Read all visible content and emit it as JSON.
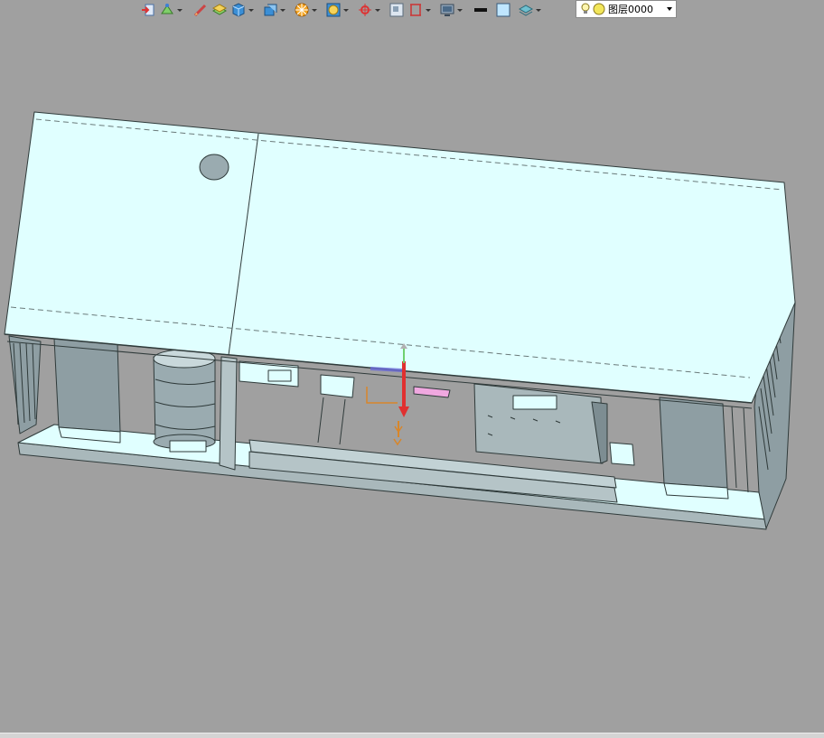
{
  "toolbar": {
    "icons": [
      "import-icon",
      "axis-insert-icon",
      "sketch-icon",
      "layer-box-icon",
      "solid-box-icon",
      "extrude-icon",
      "wheel-pattern-icon",
      "ring-icon",
      "point-constraint-icon",
      "grid-view-icon",
      "frame-view-icon",
      "monitor-view-icon",
      "black-line-icon",
      "filled-square-icon",
      "layer-stack-icon"
    ]
  },
  "layer_selector": {
    "value": "图层0000",
    "icons": [
      "lightbulb-icon",
      "layer-color-icon"
    ]
  },
  "viewport": {
    "background": "#a0a0a0",
    "model_fill": "#e0ffff",
    "model_stroke": "#2f3a3a",
    "side_fill": "#8e9ea3",
    "triad_colors": {
      "x": "#6b6bd9",
      "y": "#6fd06f",
      "z": "#e03030"
    }
  }
}
